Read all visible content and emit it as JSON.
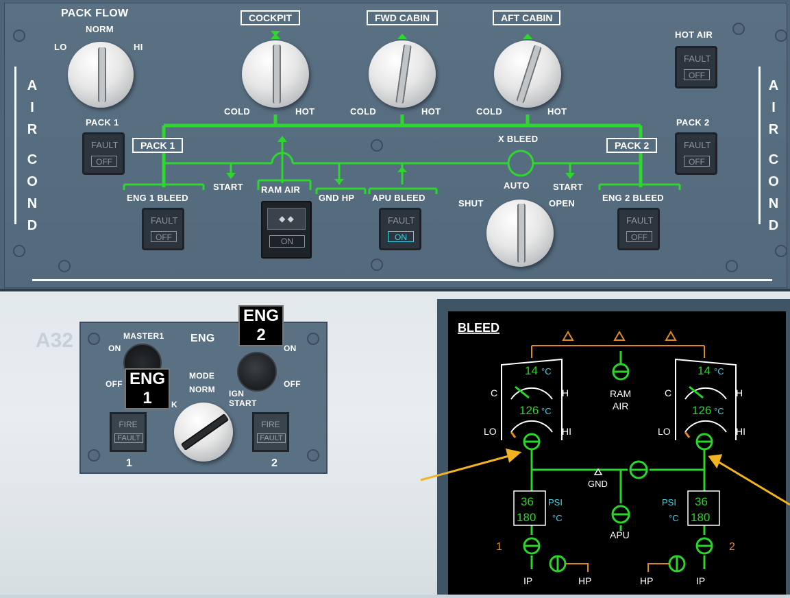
{
  "overhead": {
    "side_label_left": [
      "A",
      "I",
      "R",
      "C",
      "O",
      "N",
      "D"
    ],
    "side_label_right": [
      "A",
      "I",
      "R",
      "C",
      "O",
      "N",
      "D"
    ],
    "pack_flow": {
      "title": "PACK FLOW",
      "norm": "NORM",
      "lo": "LO",
      "hi": "HI"
    },
    "zones": [
      {
        "label": "COCKPIT",
        "cold": "COLD",
        "hot": "HOT"
      },
      {
        "label": "FWD CABIN",
        "cold": "COLD",
        "hot": "HOT"
      },
      {
        "label": "AFT CABIN",
        "cold": "COLD",
        "hot": "HOT"
      }
    ],
    "hot_air": {
      "label": "HOT AIR",
      "fault": "FAULT",
      "state": "OFF"
    },
    "pack1": {
      "label": "PACK 1",
      "fault": "FAULT",
      "state": "OFF",
      "duct_label": "PACK 1"
    },
    "pack2": {
      "label": "PACK 2",
      "fault": "FAULT",
      "state": "OFF",
      "duct_label": "PACK 2"
    },
    "eng1_bleed": {
      "label": "ENG 1 BLEED",
      "fault": "FAULT",
      "state": "OFF"
    },
    "eng2_bleed": {
      "label": "ENG 2 BLEED",
      "fault": "FAULT",
      "state": "OFF"
    },
    "apu_bleed": {
      "label": "APU BLEED",
      "fault": "FAULT",
      "state": "ON"
    },
    "ram_air": {
      "label": "RAM AIR",
      "state": "ON"
    },
    "gnd_hp": "GND HP",
    "start_left": "START",
    "start_right": "START",
    "x_bleed": {
      "title": "X BLEED",
      "auto": "AUTO",
      "shut": "SHUT",
      "open": "OPEN"
    },
    "colors": {
      "panel": "#536a7d",
      "duct": "#2fd62f",
      "text": "#ffffff"
    }
  },
  "engine_panel": {
    "master1": "MASTER1",
    "eng": "ENG",
    "on_left": "ON",
    "off_left": "OFF",
    "on_right": "ON",
    "off_right": "OFF",
    "flag_eng1_line1": "ENG",
    "flag_eng1_line2": "1",
    "flag_eng2_line1": "ENG",
    "flag_eng2_line2": "2",
    "mode": "MODE",
    "norm": "NORM",
    "crank": "K",
    "ign_line1": "IGN",
    "ign_line2": "START",
    "fire1": {
      "fire": "FIRE",
      "fault": "FAULT",
      "num": "1"
    },
    "fire2": {
      "fire": "FIRE",
      "fault": "FAULT",
      "num": "2"
    },
    "bg_text": "A32"
  },
  "ecam_bleed": {
    "title": "BLEED",
    "left": {
      "temp": "14",
      "temp_unit": "°C",
      "c": "C",
      "h": "H",
      "flow_temp": "126",
      "flow_unit": "°C",
      "lo": "LO",
      "hi": "HI",
      "psi": "36",
      "psi_unit": "PSI",
      "bleed_temp": "180",
      "bleed_unit": "°C",
      "num": "1",
      "ip": "IP",
      "hp": "HP"
    },
    "right": {
      "temp": "14",
      "temp_unit": "°C",
      "c": "C",
      "h": "H",
      "flow_temp": "126",
      "flow_unit": "°C",
      "lo": "LO",
      "hi": "HI",
      "psi": "36",
      "psi_unit": "PSI",
      "bleed_temp": "180",
      "bleed_unit": "°C",
      "num": "2",
      "ip": "IP",
      "hp": "HP"
    },
    "ram_air_line1": "RAM",
    "ram_air_line2": "AIR",
    "gnd": "GND",
    "apu": "APU",
    "colors": {
      "green": "#29d629",
      "cyan": "#3fd4e8",
      "amber": "#e08a1e",
      "white": "#ffffff"
    }
  }
}
